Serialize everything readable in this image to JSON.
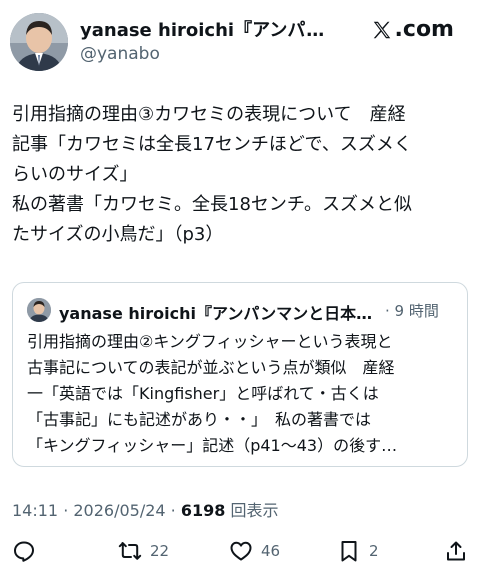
{
  "author": {
    "name": "yanase hiroichi『アンパンマンと日本人』",
    "handle": "@yanabo"
  },
  "brand": "com",
  "tweet_text": "引用指摘の理由③カワセミの表現について　産経\n記事「カワセミは全長17センチほどで、スズメく\nらいのサイズ」\n私の著書「カワセミ。全長18センチ。スズメと似\nたサイズの小鳥だ」（p3）",
  "quote": {
    "author": "yanase hiroichi『アンパンマンと日本人』",
    "time": "9 時間",
    "text": "引用指摘の理由②キングフィッシャーという表現と\n古事記についての表記が並ぶという点が類似　産経\n一「英語では「Kingfisher」と呼ばれて・古くは\n「古事記」にも記述があり・・」　私の著書では\n「キングフィッシャー」記述（p41〜43）の後す…"
  },
  "meta": {
    "time": "14:11",
    "date": "2026/05/24",
    "views": "6198",
    "views_label": "回表示"
  },
  "actions": {
    "reposts": "22",
    "likes": "46",
    "bookmarks": "2"
  }
}
